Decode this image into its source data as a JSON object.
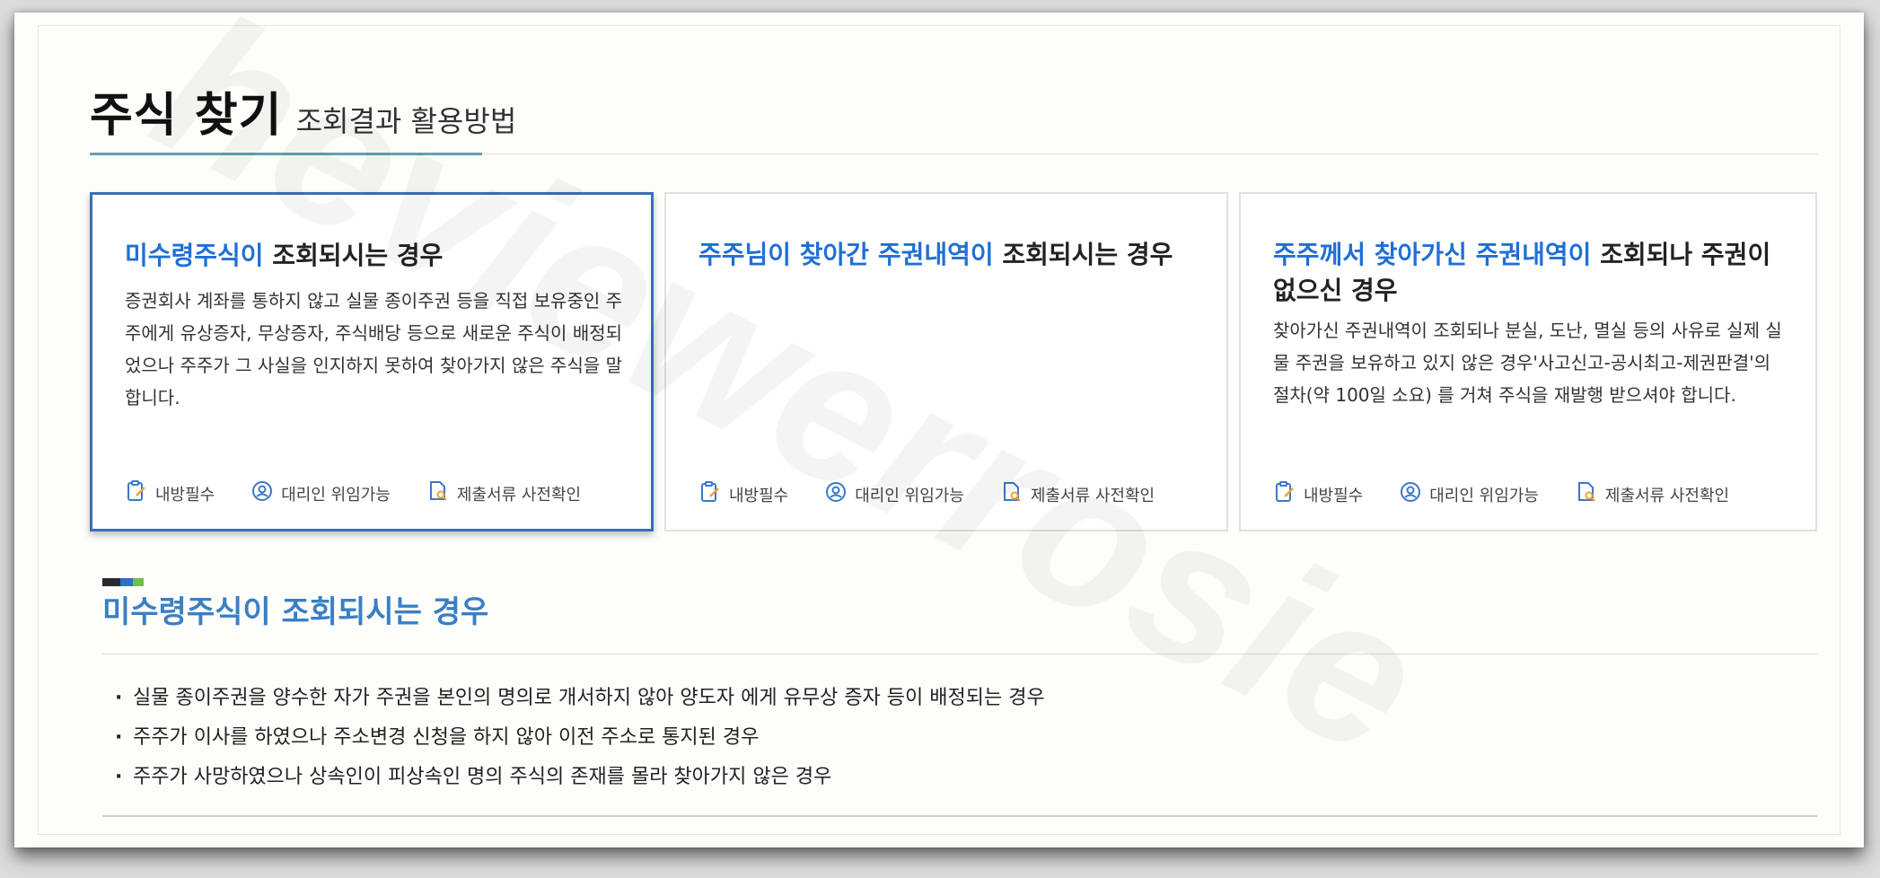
{
  "header": {
    "title": "주식 찾기",
    "subtitle": "조회결과 활용방법"
  },
  "cards": [
    {
      "title_highlight": "미수령주식이",
      "title_rest": " 조회되시는 경우",
      "description": "증권회사 계좌를 통하지 않고 실물 종이주권 등을 직접 보유중인 주주에게 유상증자, 무상증자, 주식배당 등으로 새로운 주식이 배정되었으나 주주가 그 사실을 인지하지 못하여 찾아가지 않은 주식을 말합니다.",
      "active": true
    },
    {
      "title_highlight": "주주님이 찾아간 주권내역이",
      "title_rest": " 조회되시는 경우",
      "description": "",
      "active": false
    },
    {
      "title_highlight": "주주께서 찾아가신 주권내역이",
      "title_rest": " 조회되나 주권이 없으신 경우",
      "description": "찾아가신 주권내역이 조회되나 분실, 도난, 멸실 등의 사유로 실제 실물 주권을 보유하고 있지 않은 경우'사고신고-공시최고-제권판결'의 절차(약 100일 소요) 를 거쳐 주식을 재발행 받으셔야 합니다.",
      "active": false
    }
  ],
  "tags": {
    "visit": "내방필수",
    "proxy": "대리인 위임가능",
    "docs": "제출서류 사전확인"
  },
  "section": {
    "title": "미수령주식이 조회되시는 경우",
    "items": [
      "실물 종이주권을 양수한 자가 주권을 본인의 명의로 개서하지 않아 양도자 에게 유무상 증자 등이 배정되는 경우",
      "주주가 이사를 하였으나 주소변경 신청을 하지 않아 이전 주소로 통지된 경우",
      "주주가 사망하였으나 상속인이 피상속인 명의 주식의 존재를 몰라 찾아가지 않은 경우"
    ]
  },
  "watermark": "heviewerrosie",
  "colors": {
    "highlight": "#1f6fd6",
    "active_border": "#3a6fb5",
    "section_title": "#3a7fc4",
    "accent_line": "#5fa4a8",
    "bar": [
      "#2b2b2b",
      "#2e6fc6",
      "#6cc04a"
    ]
  }
}
